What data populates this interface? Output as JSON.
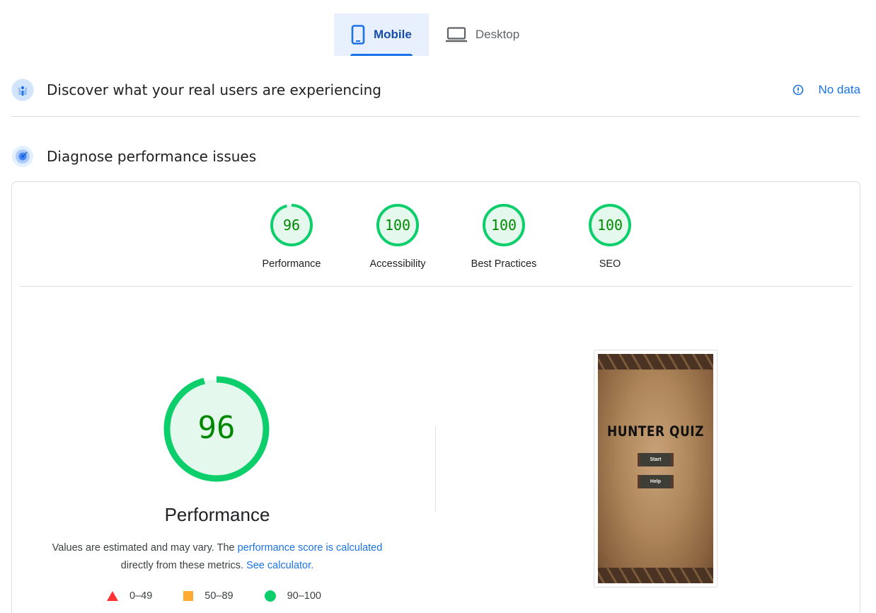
{
  "tabs": [
    {
      "label": "Mobile",
      "active": true,
      "icon": "smartphone-icon"
    },
    {
      "label": "Desktop",
      "active": false,
      "icon": "laptop-icon"
    }
  ],
  "field_data": {
    "title": "Discover what your real users are experiencing",
    "status": "No data",
    "icon": "field-data-icon"
  },
  "diagnose": {
    "title": "Diagnose performance issues",
    "icon": "radar-icon"
  },
  "scores": [
    {
      "label": "Performance",
      "value": 96
    },
    {
      "label": "Accessibility",
      "value": 100
    },
    {
      "label": "Best Practices",
      "value": 100
    },
    {
      "label": "SEO",
      "value": 100
    }
  ],
  "performance": {
    "score": 96,
    "title": "Performance",
    "desc_prefix": "Values are estimated and may vary. The ",
    "desc_link": "performance score is calculated",
    "desc_mid": " directly from these metrics. ",
    "desc_link2": "See calculator.",
    "legend": [
      {
        "range": "0–49",
        "shape": "triangle",
        "color": "#ff3333"
      },
      {
        "range": "50–89",
        "shape": "square",
        "color": "#ffaa33"
      },
      {
        "range": "90–100",
        "shape": "circle",
        "color": "#0cce6b"
      }
    ]
  },
  "screenshot": {
    "title": "HUNTER QUIZ",
    "start_label": "Start",
    "help_label": "Help"
  },
  "colors": {
    "pass": "#0cce6b",
    "pass_text": "#008800",
    "pass_fill": "#e5f8ee",
    "link": "#1a73e8"
  }
}
